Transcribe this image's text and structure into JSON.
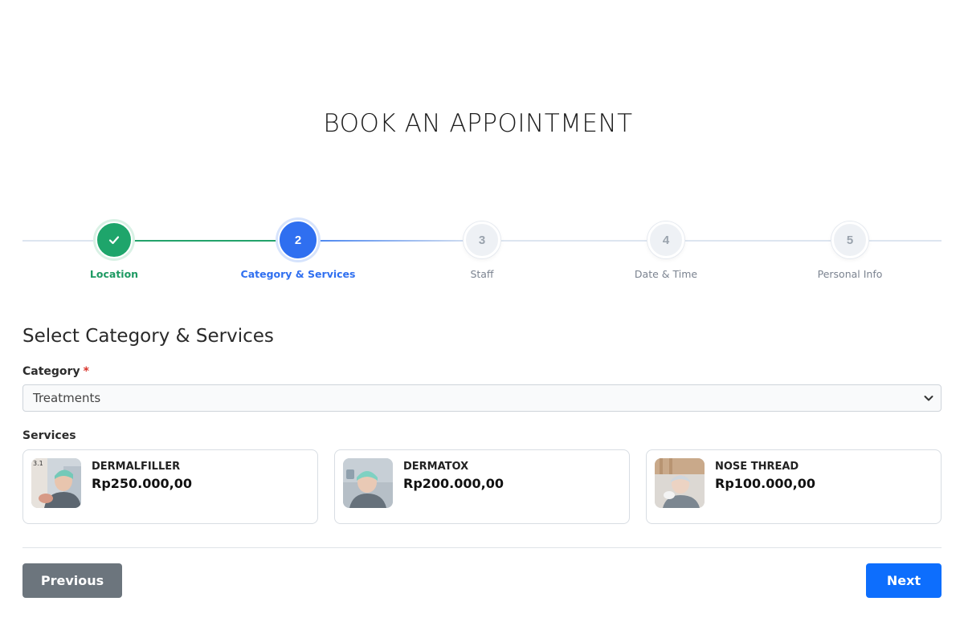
{
  "page": {
    "title": "BOOK AN APPOINTMENT"
  },
  "stepper": {
    "steps": [
      {
        "number": "1",
        "label": "Location",
        "state": "done"
      },
      {
        "number": "2",
        "label": "Category & Services",
        "state": "active"
      },
      {
        "number": "3",
        "label": "Staff",
        "state": "pending"
      },
      {
        "number": "4",
        "label": "Date & Time",
        "state": "pending"
      },
      {
        "number": "5",
        "label": "Personal Info",
        "state": "pending"
      }
    ]
  },
  "form": {
    "section_title": "Select Category & Services",
    "category_label": "Category",
    "required_mark": "*",
    "category_value": "Treatments",
    "services_label": "Services"
  },
  "services": [
    {
      "name": "DERMALFILLER",
      "price": "Rp250.000,00",
      "thumb_icon": "patient-photo"
    },
    {
      "name": "DERMATOX",
      "price": "Rp200.000,00",
      "thumb_icon": "patient-photo"
    },
    {
      "name": "NOSE THREAD",
      "price": "Rp100.000,00",
      "thumb_icon": "patient-photo"
    }
  ],
  "buttons": {
    "previous": "Previous",
    "next": "Next"
  },
  "colors": {
    "done": "#1ea56b",
    "active": "#2f6ff0",
    "pending": "#9aa3ad",
    "next_button": "#0d6efd",
    "previous_button": "#6c757d",
    "required": "#d9342b"
  }
}
